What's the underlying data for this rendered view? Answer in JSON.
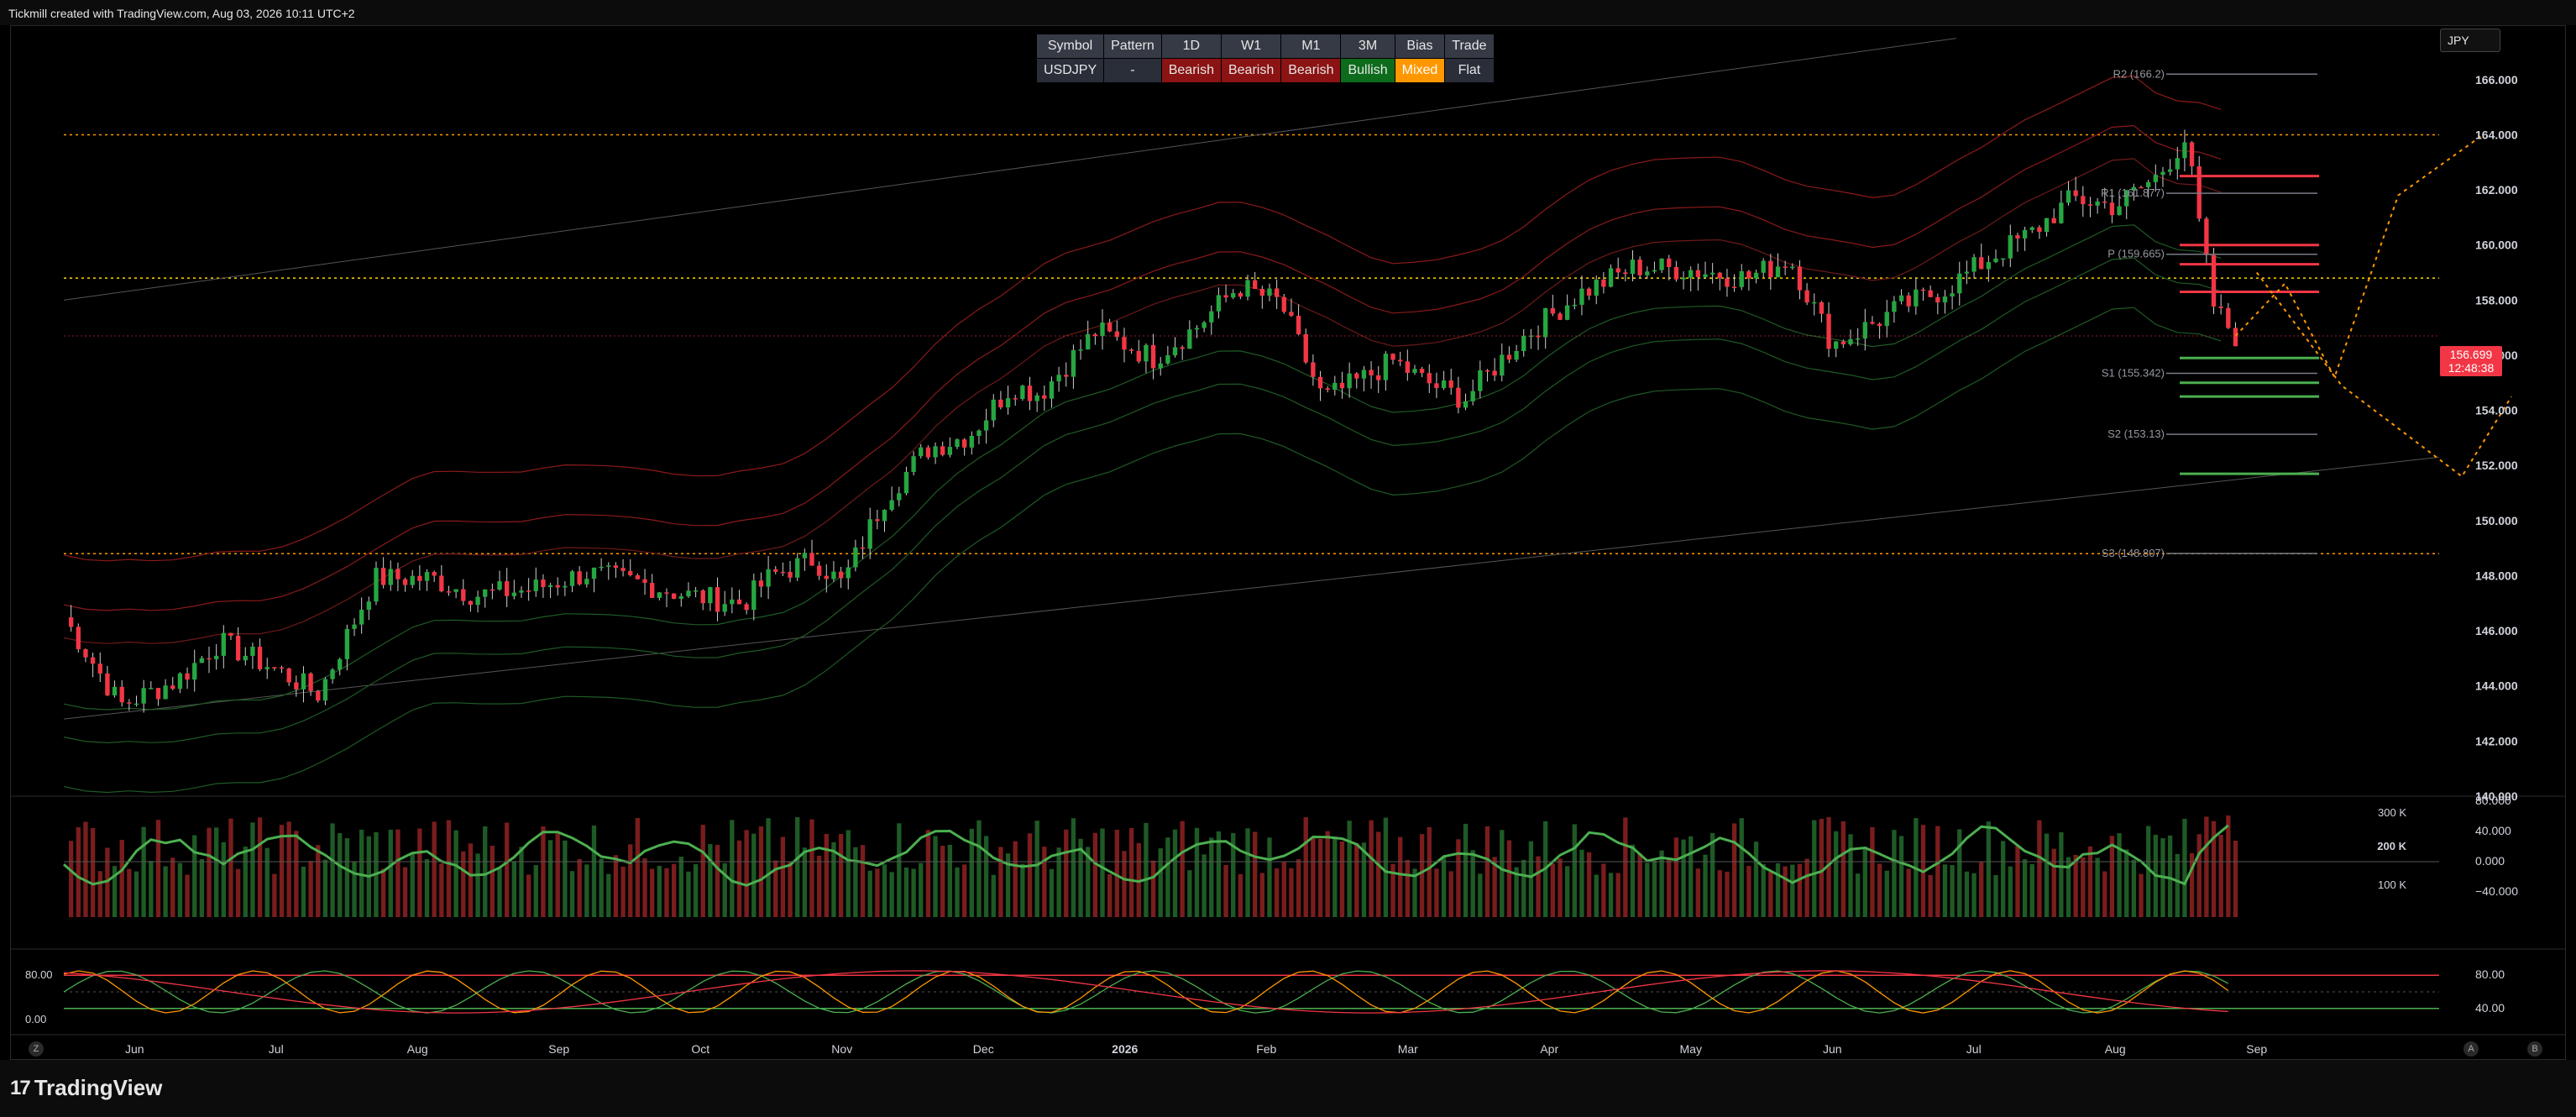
{
  "header": {
    "credit": "Tickmill created with TradingView.com, Aug 03, 2026 10:11 UTC+2"
  },
  "footer": {
    "logo": "TradingView",
    "logo_mark": "17"
  },
  "symbol_box": {
    "label": "JPY"
  },
  "status_table": {
    "headers": [
      "Symbol",
      "Pattern",
      "1D",
      "W1",
      "M1",
      "3M",
      "Bias",
      "Trade"
    ],
    "values": [
      {
        "text": "USDJPY",
        "state": "neutral"
      },
      {
        "text": "-",
        "state": "neutral"
      },
      {
        "text": "Bearish",
        "state": "bear"
      },
      {
        "text": "Bearish",
        "state": "bear"
      },
      {
        "text": "Bearish",
        "state": "bear"
      },
      {
        "text": "Bullish",
        "state": "bull"
      },
      {
        "text": "Mixed",
        "state": "mixed"
      },
      {
        "text": "Flat",
        "state": "neutral"
      }
    ]
  },
  "price_tag": {
    "price": "156.699",
    "countdown": "12:48:38"
  },
  "bottom_buttons": {
    "left": "Z",
    "a": "A",
    "b": "B"
  },
  "colors": {
    "bull": "#26a641",
    "bear": "#f23645",
    "pivot_line": "#787b86",
    "target_green": "#4caf50",
    "target_red": "#f23645",
    "dotted_orange": "#ff9800",
    "dotted_yellow": "#ffd600"
  },
  "chart_data": [
    {
      "type": "candlestick",
      "symbol": "USDJPY",
      "ylim": [
        140.0,
        167.0
      ],
      "y_ticks": [
        "140.000",
        "142.000",
        "144.000",
        "146.000",
        "148.000",
        "150.000",
        "152.000",
        "154.000",
        "156.000",
        "158.000",
        "160.000",
        "162.000",
        "164.000",
        "166.000"
      ],
      "x_ticks": [
        "Jun",
        "Jul",
        "Aug",
        "Sep",
        "Oct",
        "Nov",
        "Dec",
        "2026",
        "Feb",
        "Mar",
        "Apr",
        "May",
        "Jun",
        "Jul",
        "Aug",
        "Sep"
      ],
      "x_tick_months": [
        1,
        2,
        3,
        4,
        5,
        6,
        7,
        8,
        9,
        10,
        11,
        12,
        13,
        14,
        15,
        16
      ],
      "price_path": [
        [
          0.0,
          146.5
        ],
        [
          0.4,
          143.3
        ],
        [
          0.8,
          144.2
        ],
        [
          1.1,
          145.6
        ],
        [
          1.5,
          144.6
        ],
        [
          1.8,
          143.7
        ],
        [
          2.2,
          147.9
        ],
        [
          2.6,
          147.9
        ],
        [
          2.9,
          147.3
        ],
        [
          3.3,
          147.5
        ],
        [
          3.7,
          148.1
        ],
        [
          4.1,
          147.7
        ],
        [
          4.4,
          147.3
        ],
        [
          4.8,
          147.0
        ],
        [
          5.0,
          148.0
        ],
        [
          5.3,
          148.6
        ],
        [
          5.5,
          147.7
        ],
        [
          5.8,
          150.8
        ],
        [
          6.1,
          152.6
        ],
        [
          6.4,
          153.1
        ],
        [
          6.7,
          154.9
        ],
        [
          6.9,
          154.6
        ],
        [
          7.3,
          156.9
        ],
        [
          7.7,
          155.9
        ],
        [
          8.0,
          157.0
        ],
        [
          8.3,
          158.5
        ],
        [
          8.6,
          157.9
        ],
        [
          8.9,
          154.4
        ],
        [
          9.2,
          155.2
        ],
        [
          9.4,
          155.8
        ],
        [
          9.6,
          155.1
        ],
        [
          9.9,
          154.4
        ],
        [
          10.3,
          156.6
        ],
        [
          10.7,
          158.2
        ],
        [
          11.1,
          159.2
        ],
        [
          11.5,
          159.1
        ],
        [
          11.9,
          158.8
        ],
        [
          12.2,
          159.5
        ],
        [
          12.5,
          156.4
        ],
        [
          12.7,
          156.9
        ],
        [
          13.0,
          157.8
        ],
        [
          13.3,
          158.4
        ],
        [
          13.6,
          159.5
        ],
        [
          13.9,
          160.4
        ],
        [
          14.2,
          161.7
        ],
        [
          14.5,
          161.4
        ],
        [
          14.8,
          162.5
        ],
        [
          15.0,
          163.9
        ],
        [
          15.1,
          160.5
        ],
        [
          15.2,
          157.7
        ],
        [
          15.35,
          156.7
        ]
      ],
      "projection_path": [
        [
          15.35,
          156.7
        ],
        [
          15.7,
          158.6
        ],
        [
          16.05,
          155.2
        ],
        [
          16.5,
          161.8
        ],
        [
          17.1,
          164.0
        ]
      ],
      "projection_path_2": [
        [
          15.5,
          159.0
        ],
        [
          16.1,
          154.9
        ],
        [
          16.95,
          151.6
        ],
        [
          17.3,
          154.5
        ]
      ],
      "pivot_levels": [
        {
          "label": "R2 (166.2)",
          "value": 166.2
        },
        {
          "label": "R1 (161.877)",
          "value": 161.877
        },
        {
          "label": "P (159.665)",
          "value": 159.665
        },
        {
          "label": "S1 (155.342)",
          "value": 155.342
        },
        {
          "label": "S2 (153.13)",
          "value": 153.13
        },
        {
          "label": "S3 (148.807)",
          "value": 148.807
        }
      ],
      "target_green": [
        155.9,
        155.0,
        154.5,
        151.7
      ],
      "target_red": [
        162.5,
        160.0,
        159.3,
        158.3
      ],
      "orange_dotted_levels": [
        164.0,
        158.8,
        148.8
      ],
      "last_price": 156.699
    },
    {
      "type": "volume_bar",
      "y_ticks": [
        "100 K",
        "200 K",
        "300 K"
      ],
      "oscillator_ticks": [
        "80.000",
        "40.000",
        "0.000",
        "−40.000"
      ]
    },
    {
      "type": "line",
      "series_name": "stochastic",
      "y_ticks": [
        "80.00",
        "0.00"
      ],
      "right_ticks": [
        "80.00",
        "40.00"
      ],
      "levels": [
        80,
        20
      ]
    }
  ]
}
